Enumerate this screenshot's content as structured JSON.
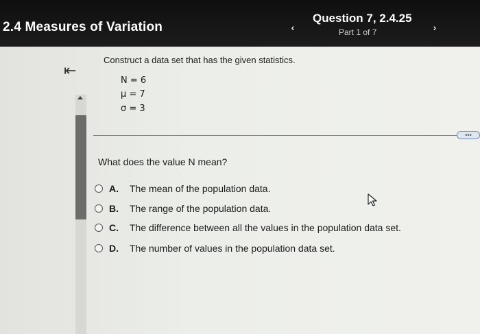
{
  "header": {
    "section_title": "2.4 Measures of Variation",
    "question_title": "Question 7, 2.4.25",
    "part_label": "Part 1 of 7",
    "prev_icon": "chevron-left-icon",
    "next_icon": "chevron-right-icon"
  },
  "sidebar": {
    "collapse_icon": "collapse-left-icon",
    "collapse_glyph": "⇤"
  },
  "problem": {
    "instruction": "Construct a data set that has the given statistics.",
    "stats": [
      {
        "text": "N = 6"
      },
      {
        "text": "μ = 7"
      },
      {
        "text": "σ = 3"
      }
    ],
    "more_label": "•••"
  },
  "question": {
    "text": "What does the value N mean?",
    "options": [
      {
        "letter": "A.",
        "text": "The mean of the population data."
      },
      {
        "letter": "B.",
        "text": "The range of the population data."
      },
      {
        "letter": "C.",
        "text": "The difference between all the values in the population data set."
      },
      {
        "letter": "D.",
        "text": "The number of values in the population data set."
      }
    ]
  },
  "colors": {
    "header_bg": "#141414",
    "content_bg": "#eceeea",
    "scroll_thumb": "#6c6d6b"
  }
}
